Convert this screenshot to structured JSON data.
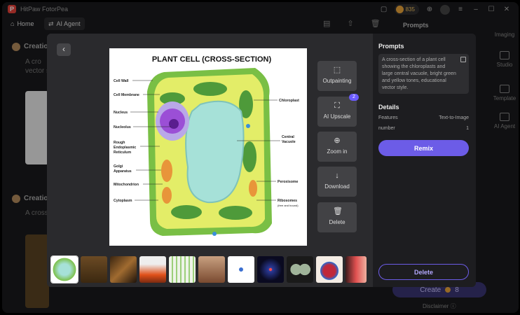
{
  "app": {
    "title": "HitPaw FotorPea",
    "coins": "835"
  },
  "nav": {
    "home": "Home",
    "agent": "AI Agent"
  },
  "sidepanel": {
    "prompts_header": "Prompts",
    "rail": [
      "Imaging",
      "Studio",
      "Template",
      "AI Agent"
    ],
    "create": "Create",
    "create_cost": "8",
    "disclaimer": "Disclaimer"
  },
  "background": {
    "item1_title": "Creatio",
    "item1_text1": "A cro",
    "item1_text2": "vector s",
    "item2_title": "Creatio",
    "item2_text": "A cross"
  },
  "image": {
    "title": "PLANT CELL (CROSS-SECTION)",
    "labels_left": [
      "Cell Wall",
      "Cell Membrane",
      "Nucleus",
      "Nucleolus",
      "Rough",
      "Endoplasmic",
      "Reticulum",
      "Golgi",
      "Apparatus",
      "Mitochondrion",
      "Cytoplasm"
    ],
    "labels_right": [
      "Chloroplast",
      "Central",
      "Vacuole",
      "Peroxisome",
      "Ribosomes",
      "(free and bound)"
    ]
  },
  "tools": {
    "outpainting": "Outpainting",
    "upscale": "AI Upscale",
    "upscale_badge": "2",
    "zoom": "Zoom in",
    "download": "Download",
    "delete": "Delete"
  },
  "details": {
    "prompts_title": "Prompts",
    "prompt_text": "A cross-section of a plant cell showing the chloroplasts and large central vacuole, bright green and yellow tones, educational vector style.",
    "details_title": "Details",
    "features_label": "Features",
    "features_value": "Text-to-Image",
    "number_label": "number",
    "number_value": "1",
    "remix": "Remix",
    "delete": "Delete"
  },
  "colors": {
    "accent": "#6c5ce7",
    "cell_wall": "#7cc04a",
    "cytoplasm": "#e4ee6a",
    "vacuole": "#a6e1d8",
    "nucleus": "#9b4fd6"
  }
}
